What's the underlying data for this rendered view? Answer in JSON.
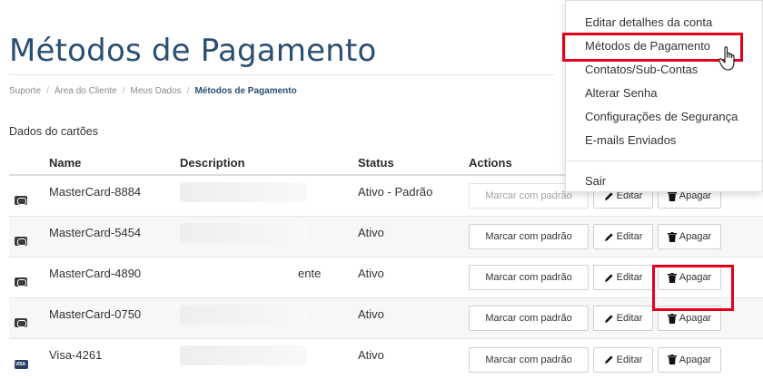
{
  "page": {
    "title": "Métodos de Pagamento",
    "breadcrumb": [
      "Suporte",
      "Área do Cliente",
      "Meus Dados",
      "Métodos de Pagamento"
    ],
    "section_label": "Dados do cartões"
  },
  "table": {
    "headers": {
      "name": "Name",
      "description": "Description",
      "status": "Status",
      "actions": "Actions"
    },
    "rows": [
      {
        "icon": "mastercard-icon",
        "name": "MasterCard-8884",
        "description": "",
        "status": "Ativo - Padrão"
      },
      {
        "icon": "mastercard-icon",
        "name": "MasterCard-5454",
        "description": "",
        "status": "Ativo"
      },
      {
        "icon": "mastercard-icon",
        "name": "MasterCard-4890",
        "description": "ente",
        "status": "Ativo"
      },
      {
        "icon": "mastercard-icon",
        "name": "MasterCard-0750",
        "description": "",
        "status": "Ativo"
      },
      {
        "icon": "visa-icon",
        "name": "Visa-4261",
        "description": "",
        "status": "Ativo"
      }
    ],
    "buttons": {
      "set_default": "Marcar com padrão",
      "edit": "Editar",
      "delete": "Apagar"
    },
    "visa_mark": "VISA"
  },
  "account_menu": {
    "items": [
      "Editar detalhes da conta",
      "Métodos de Pagamento",
      "Contatos/Sub-Contas",
      "Alterar Senha",
      "Configurações de Segurança",
      "E-mails Enviados",
      "Sair"
    ]
  },
  "colors": {
    "title": "#2a4f72",
    "highlight": "#e3001b",
    "text": "#333333"
  }
}
